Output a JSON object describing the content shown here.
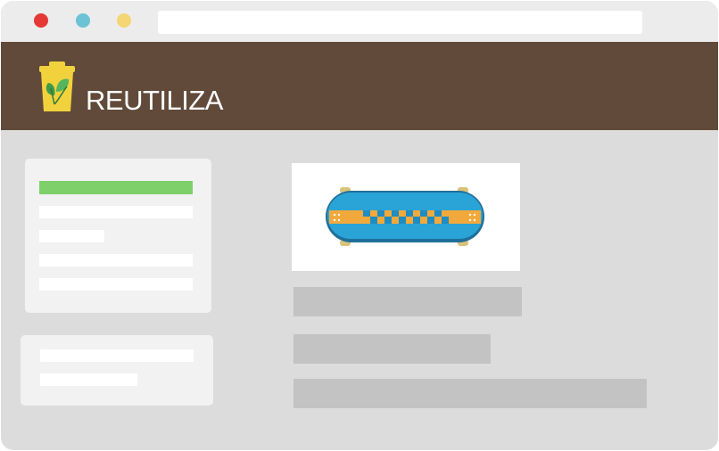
{
  "window": {
    "controls": [
      "close",
      "minimize",
      "maximize"
    ],
    "address_bar": ""
  },
  "header": {
    "brand": "REUTILIZA",
    "logo_icon": "recycle-bin-leaf-icon",
    "colors": {
      "header_bg": "#614a3a",
      "accent": "#7ed06b",
      "bin": "#f2d23c"
    }
  },
  "sidebar": {
    "card1_items": [
      "",
      "",
      "",
      "",
      ""
    ],
    "card2_items": [
      "",
      ""
    ]
  },
  "main": {
    "product_image": "skateboard-icon",
    "text_lines": [
      "",
      "",
      ""
    ]
  }
}
